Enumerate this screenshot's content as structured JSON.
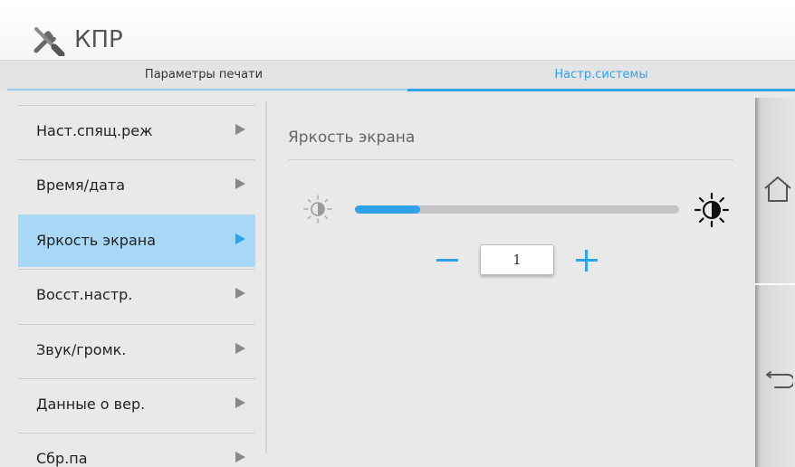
{
  "app": {
    "title": "КПР"
  },
  "tabs": [
    {
      "label": "Параметры печати",
      "active": false
    },
    {
      "label": "Настр.системы",
      "active": true
    }
  ],
  "menu": {
    "items": [
      {
        "label": "Наст.спящ.реж",
        "active": false
      },
      {
        "label": "Время/дата",
        "active": false
      },
      {
        "label": "Яркость экрана",
        "active": true
      },
      {
        "label": "Восст.настр.",
        "active": false
      },
      {
        "label": "Звук/громк.",
        "active": false
      },
      {
        "label": "Данные о вер.",
        "active": false
      },
      {
        "label": "Сбр.па",
        "active": false
      }
    ]
  },
  "content": {
    "title": "Яркость экрана",
    "brightness": {
      "value": "1",
      "slider_level": 0.2,
      "decrease_icon": "minus-icon",
      "increase_icon": "plus-icon",
      "low_icon": "brightness-low-icon",
      "high_icon": "brightness-high-icon"
    }
  },
  "side": {
    "home_icon": "home-icon",
    "back_icon": "back-icon"
  },
  "colors": {
    "accent": "#2ea3e8",
    "active_item_bg": "#a9d8f7",
    "background": "#e9e9e9"
  }
}
